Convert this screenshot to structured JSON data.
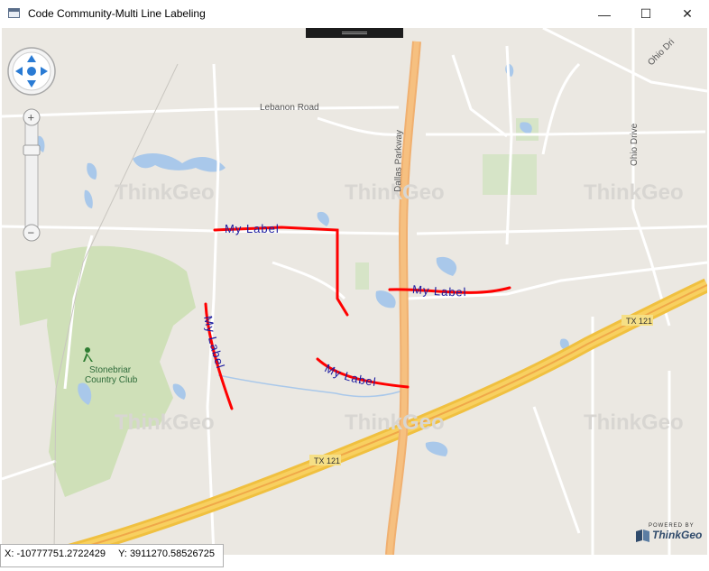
{
  "window": {
    "title": "Code Community-Multi Line Labeling",
    "minimize_glyph": "—",
    "maximize_glyph": "☐",
    "close_glyph": "✕"
  },
  "map": {
    "road_labels": {
      "lebanon_road": "Lebanon Road",
      "dallas_parkway": "Dallas Parkway",
      "ohio_drive_top": "Ohio Dri",
      "ohio_drive": "Ohio Drive",
      "tx121_upper": "TX 121",
      "tx121_lower": "TX 121"
    },
    "poi_labels": {
      "stonebriar_line1": "Stonebriar",
      "stonebriar_line2": "Country Club"
    },
    "watermark": "ThinkGeo",
    "line_labels": [
      "My Label",
      "My Label",
      "My Label",
      "My Label"
    ],
    "line_color": "#ff0000",
    "label_color": "#1a1aa0"
  },
  "navigation": {
    "pan_icons": [
      "arrow-up-icon",
      "arrow-down-icon",
      "arrow-left-icon",
      "arrow-right-icon",
      "center-icon"
    ],
    "zoom_in": "+",
    "zoom_out": "−"
  },
  "attribution": {
    "powered_by": "POWERED BY",
    "brand": "ThinkGeo"
  },
  "status": {
    "x_label": "X:",
    "x_value": "-10777751.2722429",
    "y_label": "Y:",
    "y_value": "3911270.58526725"
  }
}
